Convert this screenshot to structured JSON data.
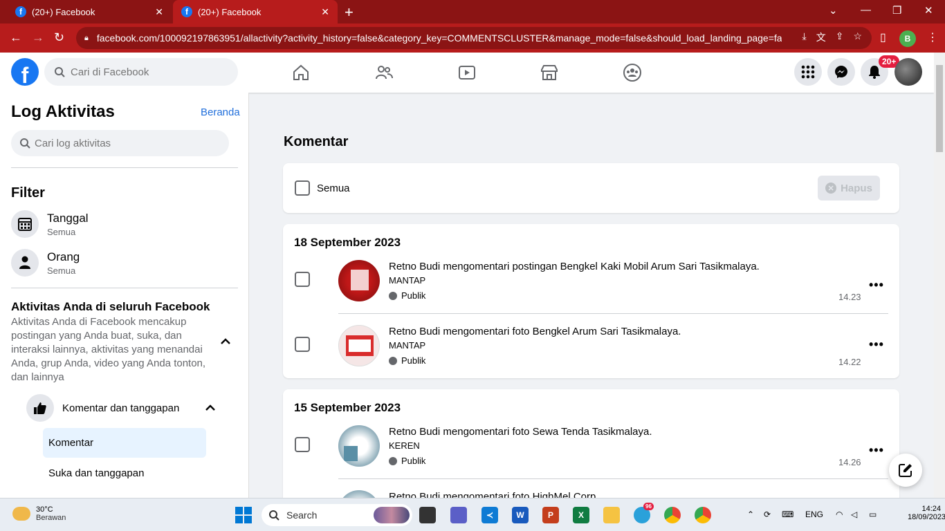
{
  "browser": {
    "tabs": [
      {
        "title": "(20+) Facebook"
      },
      {
        "title": "(20+) Facebook"
      }
    ],
    "url": "facebook.com/100092197863951/allactivity?activity_history=false&category_key=COMMENTSCLUSTER&manage_mode=false&should_load_landing_page=fa...",
    "profile_initial": "B"
  },
  "header": {
    "search_placeholder": "Cari di Facebook",
    "notification_badge": "20+"
  },
  "sidebar": {
    "title": "Log Aktivitas",
    "home_link": "Beranda",
    "search_placeholder": "Cari log aktivitas",
    "filter_title": "Filter",
    "filters": [
      {
        "label": "Tanggal",
        "value": "Semua"
      },
      {
        "label": "Orang",
        "value": "Semua"
      }
    ],
    "activity_title": "Aktivitas Anda di seluruh Facebook",
    "activity_desc": "Aktivitas Anda di Facebook mencakup postingan yang Anda buat, suka, dan interaksi lainnya, aktivitas yang menandai Anda, grup Anda, video yang Anda tonton, dan lainnya",
    "category": "Komentar dan tanggapan",
    "sub_items": [
      "Komentar",
      "Suka dan tanggapan"
    ]
  },
  "main": {
    "title": "Komentar",
    "select_all": "Semua",
    "delete_button": "Hapus",
    "groups": [
      {
        "date": "18 September 2023",
        "items": [
          {
            "name": "Retno Budi",
            "verb": "mengomentari",
            "object": "postingan Bengkel Kaki Mobil Arum Sari Tasikmalaya.",
            "comment": "MANTAP",
            "privacy": "Publik",
            "time": "14.23"
          },
          {
            "name": "Retno Budi",
            "verb": "mengomentari",
            "object": "foto Bengkel Arum Sari Tasikmalaya.",
            "comment": "MANTAP",
            "privacy": "Publik",
            "time": "14.22"
          }
        ]
      },
      {
        "date": "15 September 2023",
        "items": [
          {
            "name": "Retno Budi",
            "verb": "mengomentari",
            "object": "foto Sewa Tenda Tasikmalaya.",
            "comment": "KEREN",
            "privacy": "Publik",
            "time": "14.26"
          },
          {
            "name": "Retno Budi",
            "verb": "mengomentari",
            "object": "foto HighMel Corp.",
            "comment": "",
            "privacy": "",
            "time": ""
          }
        ]
      }
    ]
  },
  "taskbar": {
    "temperature": "30°C",
    "condition": "Berawan",
    "search": "Search",
    "telegram_badge": "96",
    "lang": "ENG",
    "time": "14:24",
    "date": "18/09/2023"
  },
  "colors": {
    "browser_frame": "#8b1414",
    "browser_active": "#b71c1c",
    "facebook_blue": "#1877f2",
    "link": "#216fdb"
  }
}
